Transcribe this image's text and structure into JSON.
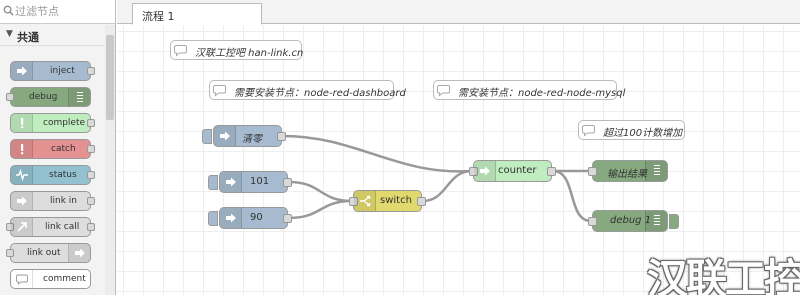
{
  "palette": {
    "search_placeholder": "过滤节点",
    "category": "共通",
    "nodes": [
      {
        "label": "inject",
        "color": "#a6bbcf",
        "icon": "arrow-right-icon"
      },
      {
        "label": "debug",
        "color": "#87a980",
        "icon": "debug-bars-icon"
      },
      {
        "label": "complete",
        "color": "#c0edc0",
        "icon": "exclamation-icon"
      },
      {
        "label": "catch",
        "color": "#e49191",
        "icon": "exclamation-icon"
      },
      {
        "label": "status",
        "color": "#94c1d0",
        "icon": "pulse-icon"
      },
      {
        "label": "link in",
        "color": "#dddddd",
        "icon": "link-icon"
      },
      {
        "label": "link call",
        "color": "#dddddd",
        "icon": "link-icon"
      },
      {
        "label": "link out",
        "color": "#dddddd",
        "icon": "link-icon"
      },
      {
        "label": "comment",
        "color": "#ffffff",
        "icon": "comment-icon"
      }
    ]
  },
  "tabs": [
    {
      "label": "流程 1"
    }
  ],
  "flow": {
    "comments": [
      {
        "text": "汉联工控吧 han-link.cn"
      },
      {
        "text": "需要安装节点：node-red-dashboard"
      },
      {
        "text": "需安装节点：node-red-node-mysql"
      },
      {
        "text": "超过100计数增加"
      }
    ],
    "nodes": {
      "reset": {
        "label": "清零",
        "color": "#a6bbcf"
      },
      "n101": {
        "label": "101",
        "color": "#a6bbcf"
      },
      "n90": {
        "label": "90",
        "color": "#a6bbcf"
      },
      "switch": {
        "label": "switch",
        "color": "#e2d96e"
      },
      "counter": {
        "label": "counter",
        "color": "#c0edc0"
      },
      "output": {
        "label": "输出结果",
        "color": "#87a980"
      },
      "debug1": {
        "label": "debug 1",
        "color": "#87a980"
      }
    }
  },
  "watermark": "汉联工控吧"
}
